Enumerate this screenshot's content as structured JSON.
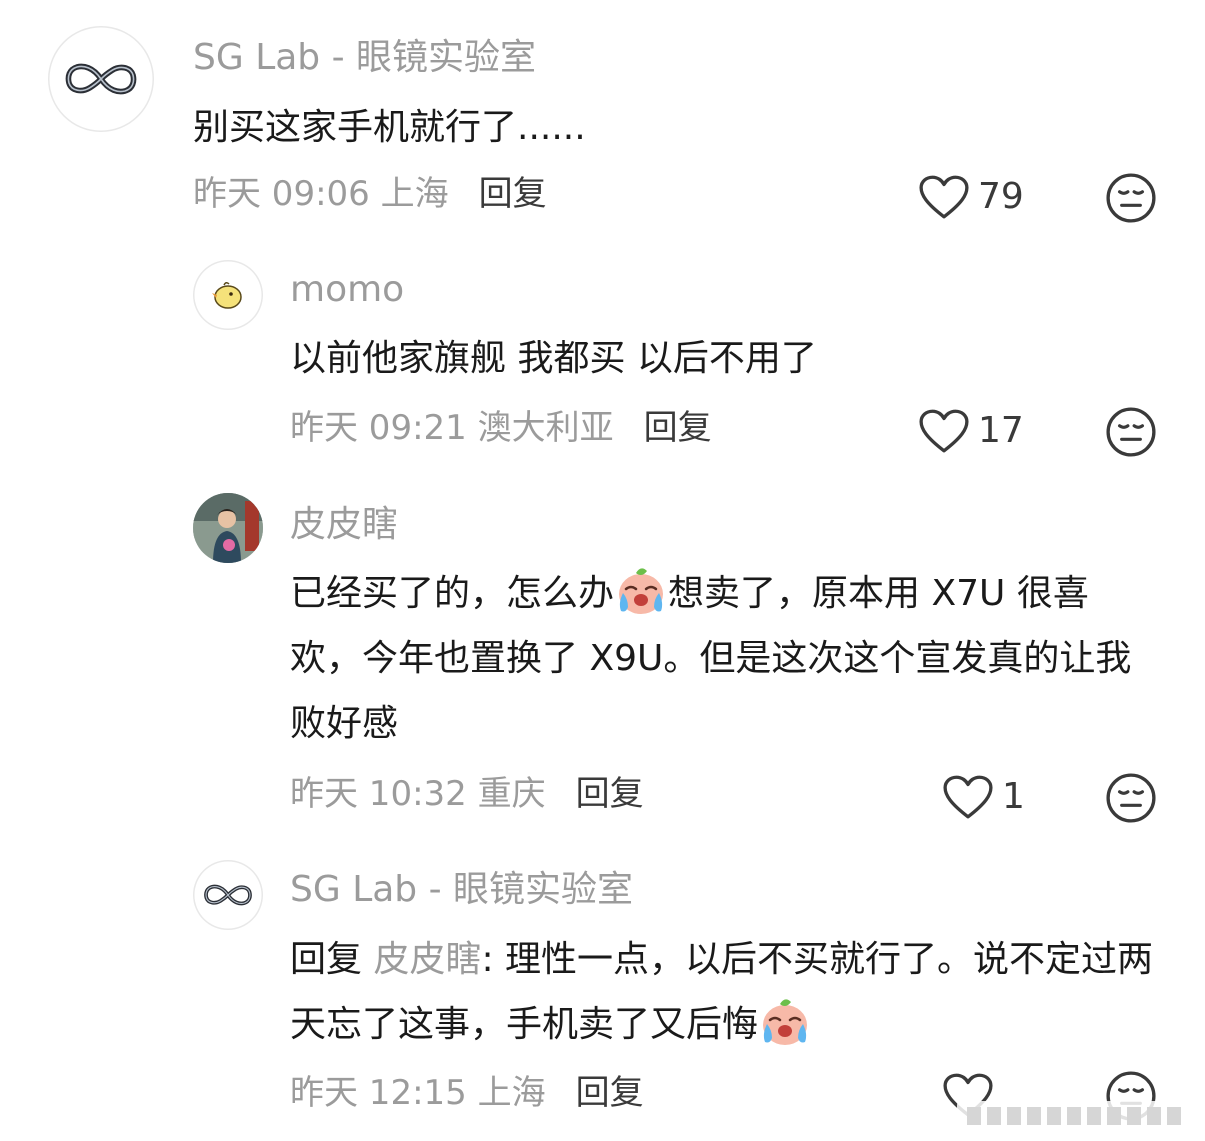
{
  "comments": [
    {
      "author": "SG Lab - 眼镜实验室",
      "text": "别买这家手机就行了......",
      "time": "昨天 09:06 上海",
      "reply_label": "回复",
      "likes": "79",
      "avatar_icon": "infinity-logo-icon"
    },
    {
      "author": "momo",
      "text": "以前他家旗舰 我都买 以后不用了",
      "time": "昨天 09:21 澳大利亚",
      "reply_label": "回复",
      "likes": "17",
      "avatar_icon": "chick-icon"
    },
    {
      "author": "皮皮瞎",
      "text_part1": "已经买了的，怎么办",
      "text_part2": "想卖了，原本用 X7U 很喜欢，今年也置换了 X9U。但是这次这个宣发真的让我败好感",
      "time": "昨天 10:32 重庆",
      "reply_label": "回复",
      "likes": "1",
      "avatar_icon": "person-photo"
    },
    {
      "author": "SG Lab - 眼镜实验室",
      "reply_prefix": "回复 ",
      "mention": "皮皮瞎",
      "text": ": 理性一点，以后不买就行了。说不定过两天忘了这事，手机卖了又后悔",
      "time": "昨天 12:15 上海",
      "reply_label": "回复",
      "avatar_icon": "infinity-logo-icon"
    }
  ],
  "colors": {
    "secondary_text": "#9b9b9b",
    "primary_text": "#1a1a1a"
  }
}
